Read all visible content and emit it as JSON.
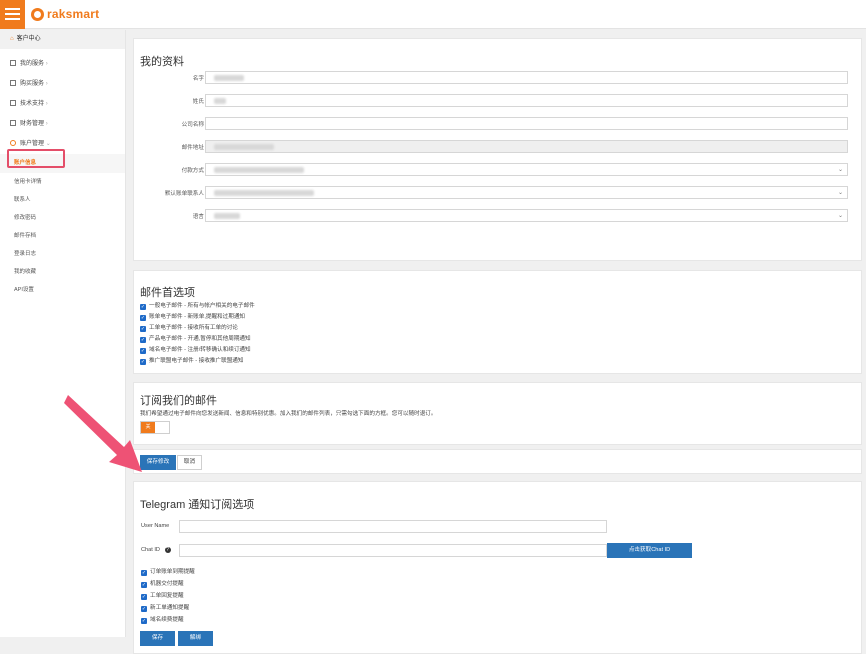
{
  "brand": {
    "name": "raksmart",
    "accent": "#f07b1d"
  },
  "sidebar": {
    "home": "客户中心",
    "groups": [
      {
        "label": "我的服务"
      },
      {
        "label": "购买服务"
      },
      {
        "label": "技术支持"
      },
      {
        "label": "财务管理"
      },
      {
        "label": "账户管理"
      }
    ],
    "active": "账户信息",
    "subitems": [
      "信用卡详情",
      "联系人",
      "修改密码",
      "邮件存档",
      "登录日志",
      "我的收藏",
      "API设置"
    ]
  },
  "profile": {
    "title": "我的资料",
    "fields": [
      {
        "label": "名字"
      },
      {
        "label": "姓氏"
      },
      {
        "label": "公司名称"
      },
      {
        "label": "邮件地址"
      },
      {
        "label": "付款方式"
      },
      {
        "label": "默认账单联系人"
      },
      {
        "label": "语言"
      }
    ]
  },
  "email_prefs": {
    "title": "邮件首选项",
    "options": [
      "一般电子邮件 - 所有与帐户相关的电子邮件",
      "账单电子邮件 - 新账单,提醒和过期通知",
      "工单电子邮件 - 接收所有工单的讨论",
      "产品电子邮件 - 开通,暂停和其他周期通知",
      "域名电子邮件 - 注册/转移确认和续订通知",
      "推广联盟电子邮件 - 接收推广联盟通知"
    ]
  },
  "subscribe": {
    "title": "订阅我们的邮件",
    "desc": "我们希望通过电子邮件向您发送新闻、信息和特别优惠。加入我们的邮件列表，只需勾选下面的方框。您可以随时退订。",
    "toggle": "关"
  },
  "actions": {
    "save": "保存修改",
    "cancel": "取消"
  },
  "telegram": {
    "title": "Telegram 通知订阅选项",
    "username_label": "User Name",
    "chatid_label": "Chat ID",
    "get_chatid": "点击获取Chat ID",
    "options": [
      "订单账单到期提醒",
      "机器交付提醒",
      "工单回复提醒",
      "新工单通知提醒",
      "域名续费提醒"
    ],
    "save": "保存",
    "unbind": "解绑"
  }
}
